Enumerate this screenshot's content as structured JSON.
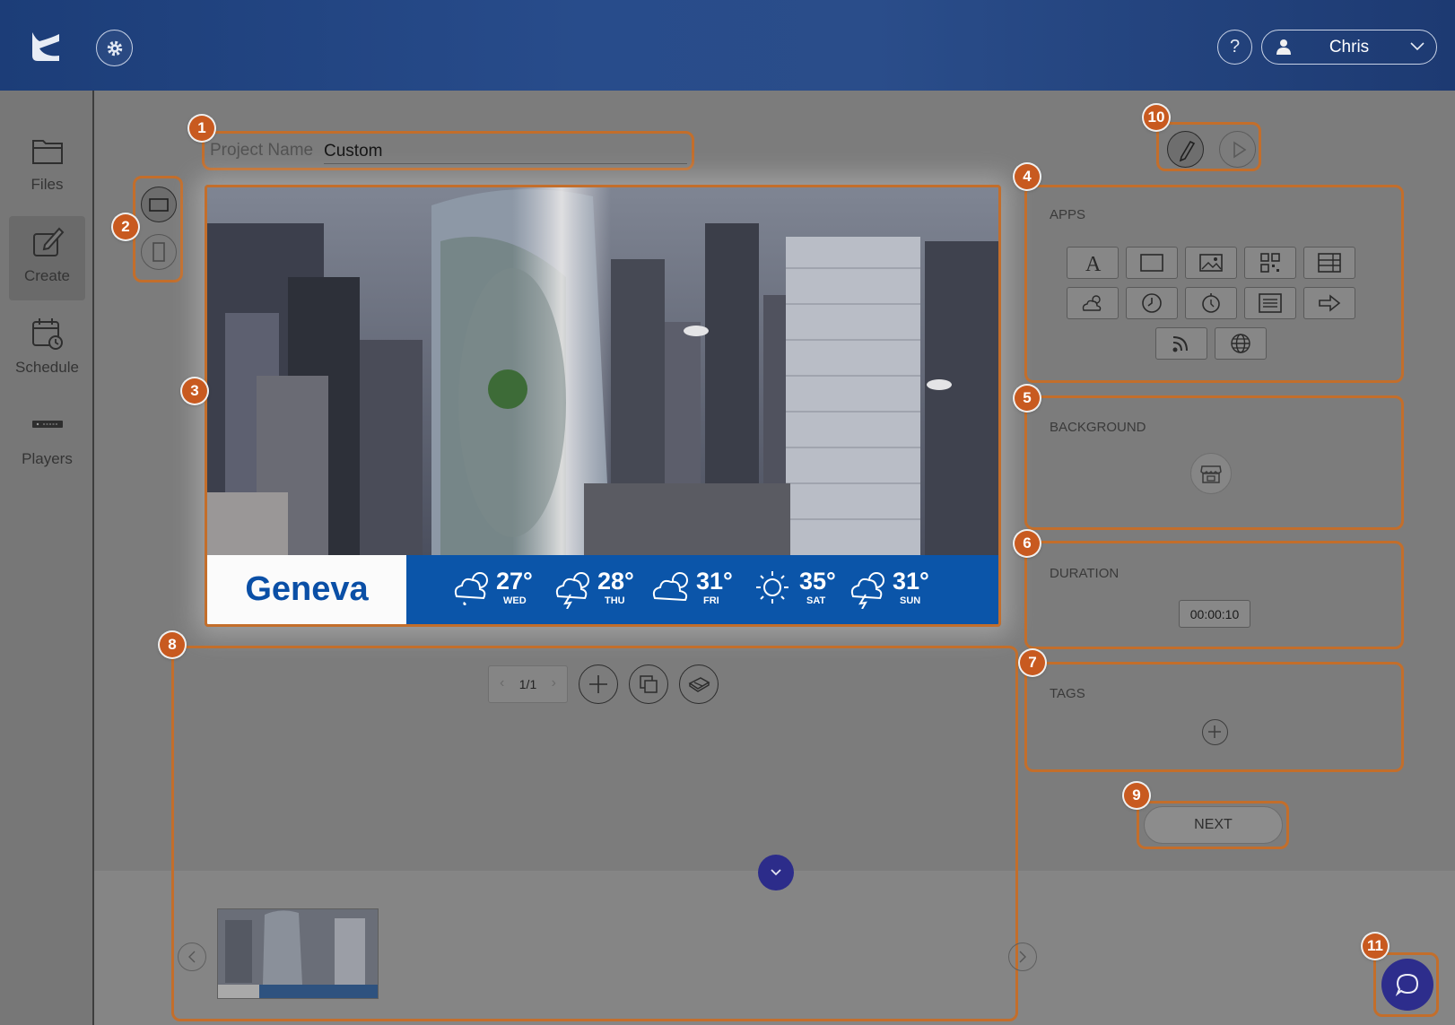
{
  "header": {
    "user_name": "Chris",
    "help_label": "?"
  },
  "sidebar": {
    "items": [
      {
        "label": "Files"
      },
      {
        "label": "Create"
      },
      {
        "label": "Schedule"
      },
      {
        "label": "Players"
      }
    ]
  },
  "project": {
    "label": "Project Name",
    "value": "Custom"
  },
  "markers": [
    "1",
    "2",
    "3",
    "4",
    "5",
    "6",
    "7",
    "8",
    "9",
    "10",
    "11"
  ],
  "preview": {
    "city": "Geneva",
    "forecast": [
      {
        "temp": "27°",
        "day": "WED",
        "icon": "rain-cloud-icon"
      },
      {
        "temp": "28°",
        "day": "THU",
        "icon": "storm-cloud-icon"
      },
      {
        "temp": "31°",
        "day": "FRI",
        "icon": "partly-cloudy-icon"
      },
      {
        "temp": "35°",
        "day": "SAT",
        "icon": "sun-icon"
      },
      {
        "temp": "31°",
        "day": "SUN",
        "icon": "storm-cloud-icon"
      }
    ]
  },
  "panels": {
    "apps_title": "APPS",
    "background_title": "BACKGROUND",
    "duration_title": "DURATION",
    "duration_value": "00:00:10",
    "tags_title": "TAGS"
  },
  "pager": {
    "value": "1/1"
  },
  "next_label": "NEXT",
  "colors": {
    "header": "#284c8b",
    "highlight": "#c36e2b",
    "marker": "#c85a20",
    "weather_bar": "#0b55a9",
    "fab": "#2d2d8c"
  }
}
